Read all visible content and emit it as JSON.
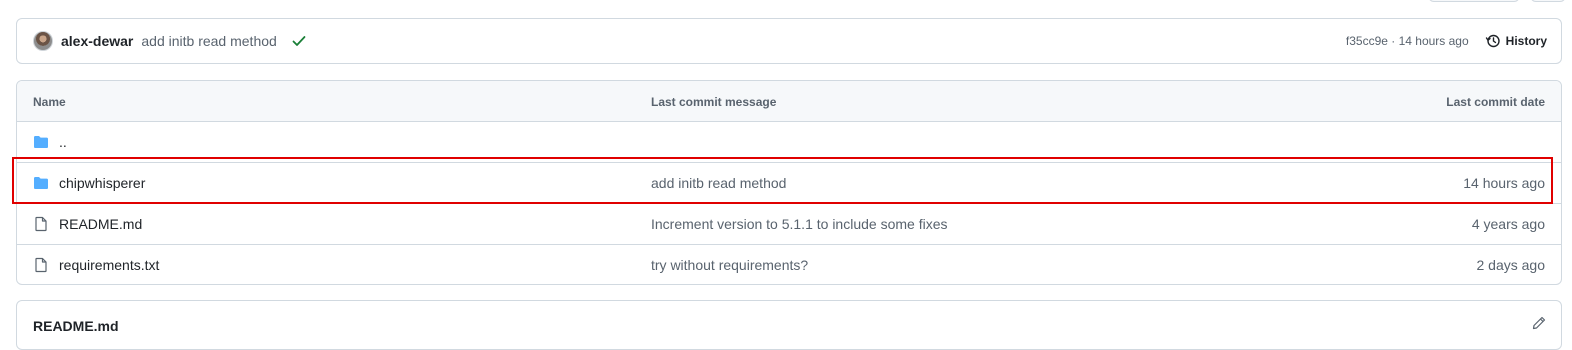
{
  "commit": {
    "author": "alex-dewar",
    "message": "add initb read method",
    "status_icon": "check-icon",
    "hash_time": "f35cc9e · 14 hours ago",
    "history_label": "History"
  },
  "table": {
    "headers": {
      "name": "Name",
      "message": "Last commit message",
      "date": "Last commit date"
    },
    "rows": [
      {
        "icon": "folder-icon",
        "name": "..",
        "message": "",
        "date": ""
      },
      {
        "icon": "folder-icon",
        "name": "chipwhisperer",
        "message": "add initb read method",
        "date": "14 hours ago"
      },
      {
        "icon": "file-icon",
        "name": "README.md",
        "message": "Increment version to 5.1.1 to include some fixes",
        "date": "4 years ago"
      },
      {
        "icon": "file-icon",
        "name": "requirements.txt",
        "message": "try without requirements?",
        "date": "2 days ago"
      }
    ]
  },
  "readme": {
    "title": "README.md",
    "edit_icon": "pencil-icon"
  },
  "colors": {
    "folder": "#54aeff",
    "check": "#1a7f37",
    "highlight": "#e00000",
    "border": "#d1d9e0"
  }
}
